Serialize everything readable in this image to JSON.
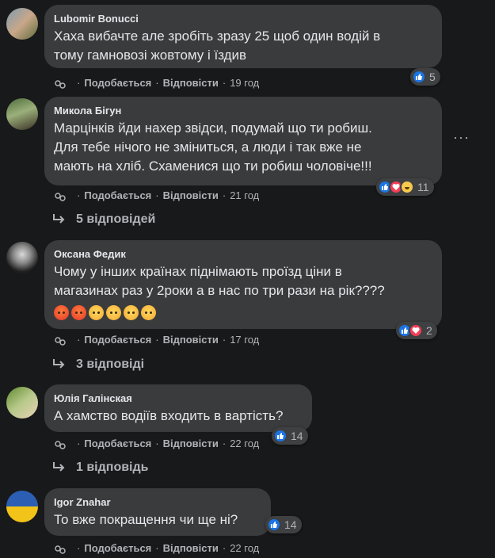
{
  "comments": [
    {
      "author": "Lubomir Bonucci",
      "text": "Хаха вибачте але зробіть зразу 25 щоб один водій в\nтому гамновозі жовтому і їздив",
      "like_label": "Подобається",
      "reply_label": "Відповісти",
      "time": "19 год",
      "reaction_count": "5"
    },
    {
      "author": "Микола Бігун",
      "text": "Марцінків йди нахер звідси, подумай що ти робиш.\nДля тебе нічого не зміниться, а люди і так вже не\nмають на хліб. Схаменися що ти робиш чоловіче!!!",
      "like_label": "Подобається",
      "reply_label": "Відповісти",
      "time": "21 год",
      "reaction_count": "11",
      "replies_label": "5 відповідей"
    },
    {
      "author": "Оксана Федик",
      "text": "Чому у інших країнах піднімають проїзд ціни в\nмагазинах раз у 2роки а в нас по три рази на рік????",
      "like_label": "Подобається",
      "reply_label": "Відповісти",
      "time": "17 год",
      "reaction_count": "2",
      "replies_label": "3 відповіді"
    },
    {
      "author": "Юлія Галінская",
      "text": "А хамство водіїв входить в вартість?",
      "like_label": "Подобається",
      "reply_label": "Відповісти",
      "time": "22 год",
      "reaction_count": "14",
      "replies_label": "1 відповідь"
    },
    {
      "author": "Igor Znahar",
      "text": "То вже покращення чи ще ні?",
      "like_label": "Подобається",
      "reply_label": "Відповісти",
      "time": "22 год",
      "reaction_count": "14"
    }
  ],
  "icons": {
    "more": "more-horizontal-icon",
    "share": "share-icon",
    "reply_arrow": "reply-arrow-icon"
  },
  "colors": {
    "background": "#18191a",
    "bubble": "#3a3b3c",
    "like_blue": "#1b74e4",
    "love_red": "#f33e58"
  }
}
